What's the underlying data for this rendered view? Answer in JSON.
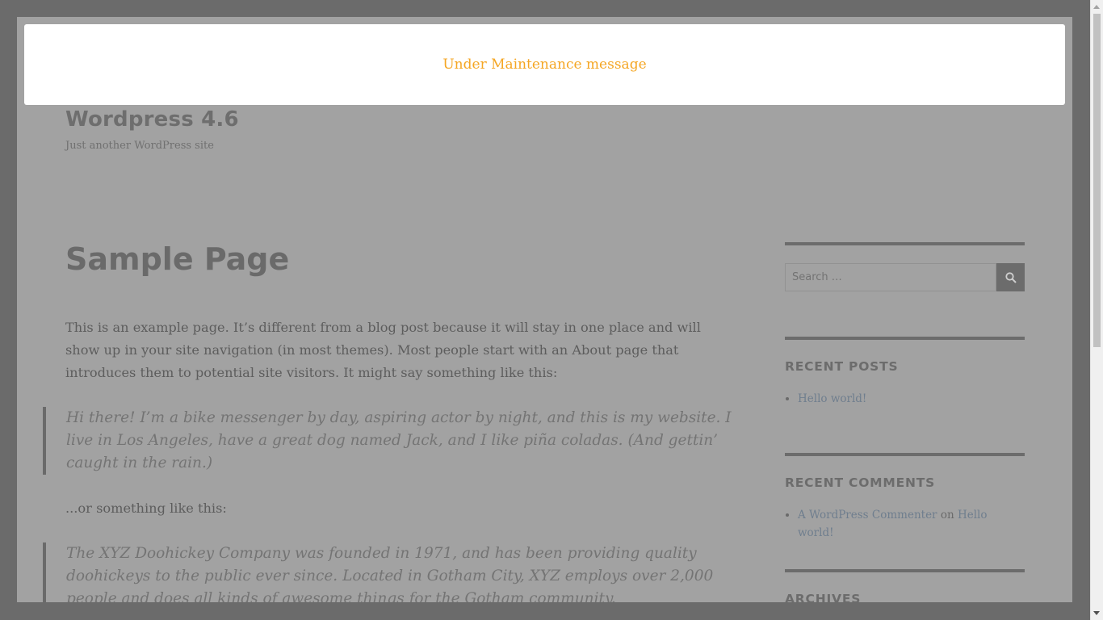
{
  "banner": {
    "message": "Under Maintenance message",
    "color": "#f5a623"
  },
  "site": {
    "title": "Wordpress 4.6",
    "description": "Just another WordPress site"
  },
  "page": {
    "title": "Sample Page",
    "paragraph1": "This is an example page. It’s different from a blog post because it will stay in one place and will show up in your site navigation (in most themes). Most people start with an About page that introduces them to potential site visitors. It might say something like this:",
    "quote1": "Hi there! I’m a bike messenger by day, aspiring actor by night, and this is my website. I live in Los Angeles, have a great dog named Jack, and I like piña coladas. (And gettin’ caught in the rain.)",
    "paragraph2": "...or something like this:",
    "quote2": "The XYZ Doohickey Company was founded in 1971, and has been providing quality doohickeys to the public ever since. Located in Gotham City, XYZ employs over 2,000 people and does all kinds of awesome things for the Gotham community."
  },
  "sidebar": {
    "search": {
      "placeholder": "Search …",
      "button_icon": "search-icon"
    },
    "recent_posts": {
      "title": "RECENT POSTS",
      "items": [
        "Hello world!"
      ]
    },
    "recent_comments": {
      "title": "RECENT COMMENTS",
      "author": "A WordPress Commenter",
      "connector": "on",
      "post": "Hello world!"
    },
    "archives": {
      "title": "ARCHIVES"
    }
  }
}
